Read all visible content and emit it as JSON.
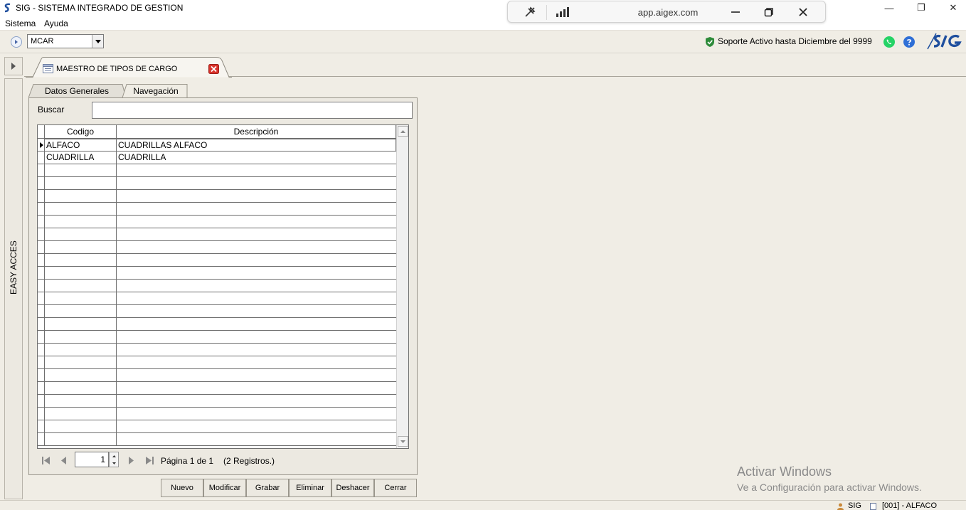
{
  "window": {
    "title": "SIG - SISTEMA INTEGRADO DE GESTION",
    "minimize_glyph": "—",
    "maximize_glyph": "❐",
    "close_glyph": "✕"
  },
  "menu": [
    "Sistema",
    "Ayuda"
  ],
  "remote_bar": {
    "url": "app.aigex.com"
  },
  "toolbar": {
    "company": "MCAR",
    "support_text": "Soporte Activo hasta Diciembre del 9999"
  },
  "side_panel": {
    "label": "EASY ACCES"
  },
  "document_tab": {
    "title": "MAESTRO DE TIPOS DE CARGO"
  },
  "tabs": [
    {
      "label": "Datos Generales"
    },
    {
      "label": "Navegación"
    }
  ],
  "search": {
    "label": "Buscar",
    "value": ""
  },
  "grid": {
    "columns": [
      "Codigo",
      "Descripción"
    ],
    "rows": [
      {
        "code": "ALFACO",
        "description": "CUADRILLAS ALFACO"
      },
      {
        "code": "CUADRILLA",
        "description": "CUADRILLA"
      }
    ],
    "selected_index": 0
  },
  "navigator": {
    "current_page": "1",
    "page_text": "Página 1 de 1",
    "records_text": "(2 Registros.)"
  },
  "buttons": [
    "Nuevo",
    "Modificar",
    "Grabar",
    "Eliminar",
    "Deshacer",
    "Cerrar"
  ],
  "activation": {
    "title": "Activar Windows",
    "subtitle": "Ve a Configuración para activar Windows."
  },
  "status": {
    "app": "SIG",
    "company": "[001] - ALFACO"
  },
  "colors": {
    "background": "#f0ede5",
    "whatsapp": "#25d366",
    "help": "#2f6fd6",
    "shield": "#2e8b3a",
    "close_red": "#d9322b",
    "logo_blue": "#1f4f9e"
  }
}
